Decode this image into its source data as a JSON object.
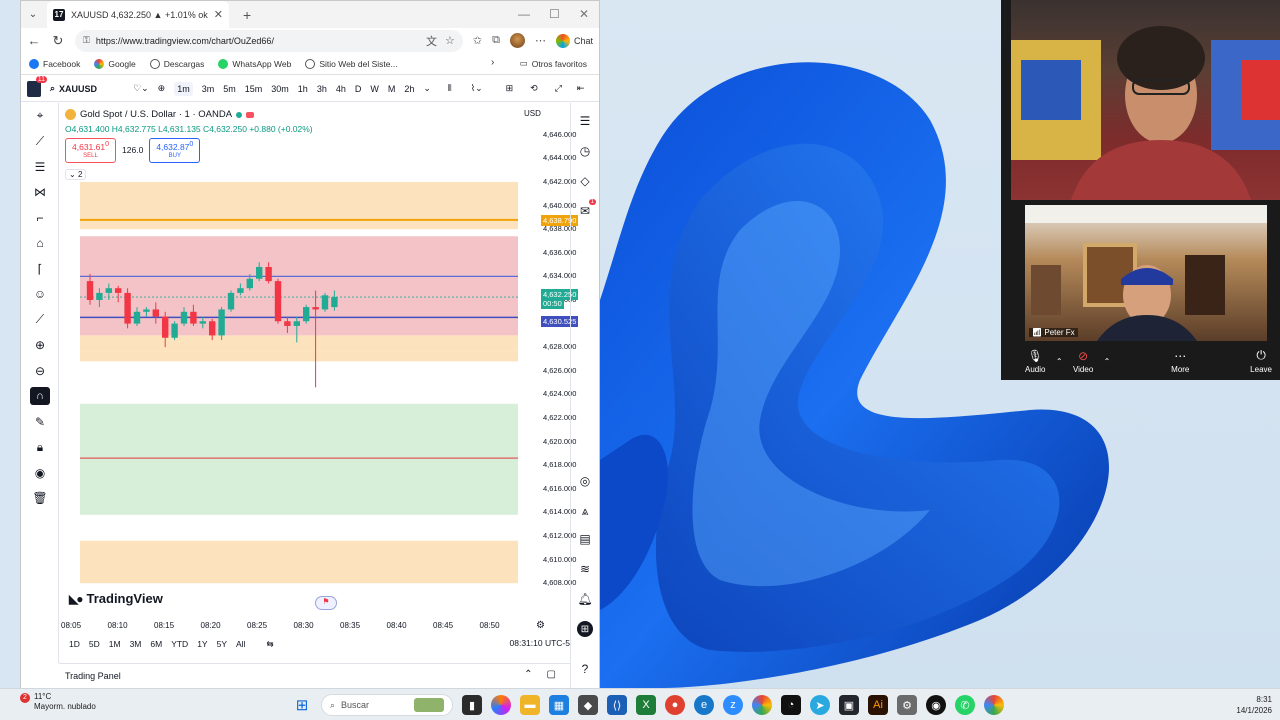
{
  "browser": {
    "tab_title": "XAUUSD 4,632.250 ▲ +1.01% ok",
    "url": "https://www.tradingview.com/chart/OuZed66/",
    "chat_label": "Chat",
    "bookmarks": [
      "Facebook",
      "Google",
      "Descargas",
      "WhatsApp Web",
      "Sitio Web del Siste..."
    ],
    "other_favorites": "Otros favoritos"
  },
  "tv": {
    "symbol": "XAUUSD",
    "intervals": [
      "1m",
      "3m",
      "5m",
      "15m",
      "30m",
      "1h",
      "3h",
      "4h",
      "D",
      "W",
      "M",
      "2h"
    ],
    "active_interval": "1m",
    "title": "Gold Spot / U.S. Dollar · 1 · OANDA",
    "ohlc": "O4,631.400 H4,632.775 L4,631.135 C4,632.250 +0.880 (+0.02%)",
    "sell_price": "4,631.61",
    "sell_sup": "0",
    "sell_label": "SELL",
    "spread": "126.0",
    "buy_price": "4,632.87",
    "buy_sup": "0",
    "buy_label": "BUY",
    "indicator_count": "2",
    "currency": "USD",
    "alert_badge": "1",
    "notif_badge": "11",
    "price_ticks": [
      "4,646.000",
      "4,644.000",
      "4,642.000",
      "4,640.000",
      "4,638.000",
      "4,636.000",
      "4,634.000",
      "4,632.000",
      "4,630.000",
      "4,628.000",
      "4,626.000",
      "4,624.000",
      "4,622.000",
      "4,620.000",
      "4,618.000",
      "4,616.000",
      "4,614.000",
      "4,612.000",
      "4,610.000",
      "4,608.000"
    ],
    "label_orange": "4,638.790",
    "label_green_price": "4,632.250",
    "label_green_time": "00:50",
    "label_blue": "4,630.525",
    "watermark": "TradingView",
    "time_ticks": [
      "08:05",
      "08:10",
      "08:15",
      "08:20",
      "08:25",
      "08:30",
      "08:35",
      "08:40",
      "08:45",
      "08:50"
    ],
    "ranges": [
      "1D",
      "5D",
      "1M",
      "3M",
      "6M",
      "YTD",
      "1Y",
      "5Y",
      "All"
    ],
    "clock": "08:31:10 UTC-5",
    "trading_panel": "Trading Panel",
    "colors": {
      "up": "#22ab94",
      "down": "#f23645",
      "supply_zone": "#f3c3c7",
      "demand_zone": "#d7efd9",
      "orange_zone": "#fde3bd"
    }
  },
  "chart_data": {
    "type": "candlestick",
    "title": "Gold Spot / U.S. Dollar · 1 · OANDA",
    "x": [
      "08:05",
      "08:06",
      "08:07",
      "08:08",
      "08:09",
      "08:10",
      "08:11",
      "08:12",
      "08:13",
      "08:14",
      "08:15",
      "08:16",
      "08:17",
      "08:18",
      "08:19",
      "08:20",
      "08:21",
      "08:22",
      "08:23",
      "08:24",
      "08:25",
      "08:26",
      "08:27",
      "08:28",
      "08:29",
      "08:30",
      "08:31"
    ],
    "ohlc": [
      [
        4633.6,
        4634.2,
        4631.6,
        4632.0
      ],
      [
        4632.0,
        4633.0,
        4631.4,
        4632.6
      ],
      [
        4632.6,
        4633.4,
        4632.0,
        4633.0
      ],
      [
        4633.0,
        4633.2,
        4631.8,
        4632.6
      ],
      [
        4632.6,
        4633.0,
        4629.6,
        4630.0
      ],
      [
        4630.0,
        4631.4,
        4629.8,
        4631.0
      ],
      [
        4631.0,
        4631.4,
        4630.6,
        4631.2
      ],
      [
        4631.2,
        4631.8,
        4630.0,
        4630.6
      ],
      [
        4630.6,
        4631.0,
        4628.0,
        4628.8
      ],
      [
        4628.8,
        4630.2,
        4628.6,
        4630.0
      ],
      [
        4630.0,
        4631.4,
        4629.8,
        4631.0
      ],
      [
        4631.0,
        4631.6,
        4629.8,
        4630.0
      ],
      [
        4630.0,
        4630.6,
        4629.6,
        4630.2
      ],
      [
        4630.2,
        4630.4,
        4628.6,
        4629.0
      ],
      [
        4629.0,
        4631.4,
        4628.6,
        4631.2
      ],
      [
        4631.2,
        4632.8,
        4631.0,
        4632.6
      ],
      [
        4632.6,
        4633.4,
        4632.4,
        4633.0
      ],
      [
        4633.0,
        4634.2,
        4632.8,
        4633.8
      ],
      [
        4633.8,
        4635.2,
        4633.6,
        4634.8
      ],
      [
        4634.8,
        4635.2,
        4633.4,
        4633.6
      ],
      [
        4633.6,
        4633.8,
        4630.0,
        4630.2
      ],
      [
        4630.2,
        4630.6,
        4629.2,
        4629.8
      ],
      [
        4629.8,
        4630.6,
        4628.4,
        4630.2
      ],
      [
        4630.2,
        4631.6,
        4630.0,
        4631.4
      ],
      [
        4631.4,
        4632.8,
        4624.6,
        4631.2
      ],
      [
        4631.2,
        4632.6,
        4631.0,
        4632.4
      ],
      [
        4631.4,
        4632.8,
        4631.1,
        4632.25
      ]
    ],
    "levels": {
      "orange_line": 4638.79,
      "blue_upper": 4634.0,
      "blue_lower": 4630.525,
      "red_line": 4618.6,
      "current": 4632.25
    },
    "zones": [
      {
        "kind": "orange",
        "from": 4638.0,
        "to": 4642.0
      },
      {
        "kind": "supply",
        "from": 4629.0,
        "to": 4637.4
      },
      {
        "kind": "orange",
        "from": 4627.6,
        "to": 4629.0
      },
      {
        "kind": "orange",
        "from": 4626.8,
        "to": 4627.6
      },
      {
        "kind": "demand",
        "from": 4613.8,
        "to": 4623.2
      },
      {
        "kind": "orange",
        "from": 4608.0,
        "to": 4611.6
      }
    ],
    "ylim": [
      4607,
      4647
    ],
    "ylabel": "USD"
  },
  "call": {
    "participant": "Peter Fx",
    "buttons": [
      "Audio",
      "Video",
      "More",
      "Leave"
    ]
  },
  "taskbar": {
    "temp": "11°C",
    "weather": "Mayorm. nublado",
    "search_placeholder": "Buscar",
    "weather_badge": "2",
    "time": "8:31",
    "date": "14/1/2026"
  }
}
